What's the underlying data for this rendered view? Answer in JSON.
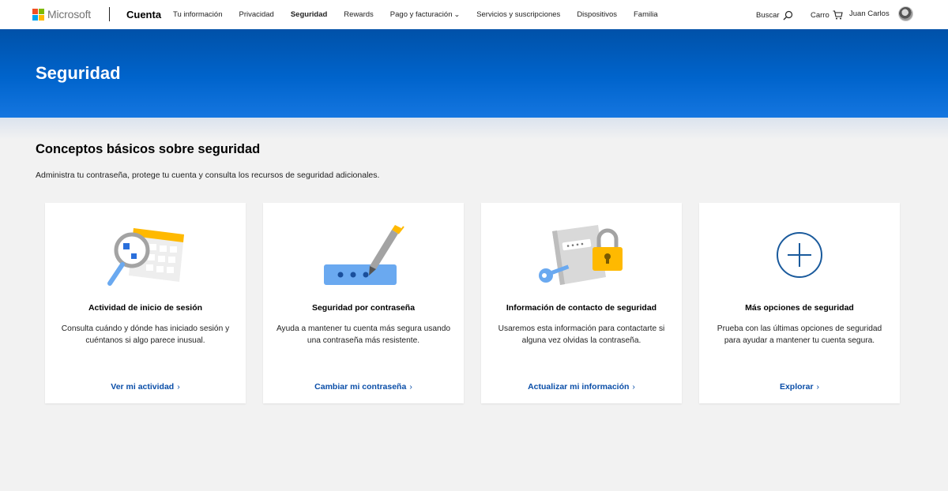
{
  "header": {
    "logo_text": "Microsoft",
    "brand": "Cuenta",
    "nav": [
      {
        "label": "Tu información"
      },
      {
        "label": "Privacidad"
      },
      {
        "label": "Seguridad"
      },
      {
        "label": "Rewards"
      },
      {
        "label": "Pago y facturación"
      },
      {
        "label": "Servicios y suscripciones"
      },
      {
        "label": "Dispositivos"
      },
      {
        "label": "Familia"
      }
    ],
    "search_label": "Buscar",
    "cart_label": "Carro",
    "user_name": "Juan Carlos"
  },
  "banner": {
    "title": "Seguridad"
  },
  "section": {
    "title": "Conceptos básicos sobre seguridad",
    "subtitle": "Administra tu contraseña, protege tu cuenta y consulta los recursos de seguridad adicionales."
  },
  "cards": [
    {
      "icon": "calendar-magnifier-icon",
      "title": "Actividad de inicio de sesión",
      "description": "Consulta cuándo y dónde has iniciado sesión y cuéntanos si algo parece inusual.",
      "link": "Ver mi actividad"
    },
    {
      "icon": "password-pen-icon",
      "title": "Seguridad por contraseña",
      "description": "Ayuda a mantener tu cuenta más segura usando una contraseña más resistente.",
      "link": "Cambiar mi contraseña"
    },
    {
      "icon": "notebook-lock-key-icon",
      "title": "Información de contacto de seguridad",
      "description": "Usaremos esta información para contactarte si alguna vez olvidas la contraseña.",
      "link": "Actualizar mi información"
    },
    {
      "icon": "plus-circle-icon",
      "title": "Más opciones de seguridad",
      "description": "Prueba con las últimas opciones de seguridad para ayudar a mantener tu cuenta segura.",
      "link": "Explorar"
    }
  ],
  "colors": {
    "accent_blue": "#0064cc",
    "link_blue": "#0a4ea8",
    "ms_red": "#f25022",
    "ms_green": "#7fba00",
    "ms_blue": "#00a4ef",
    "ms_yellow": "#ffb900"
  }
}
